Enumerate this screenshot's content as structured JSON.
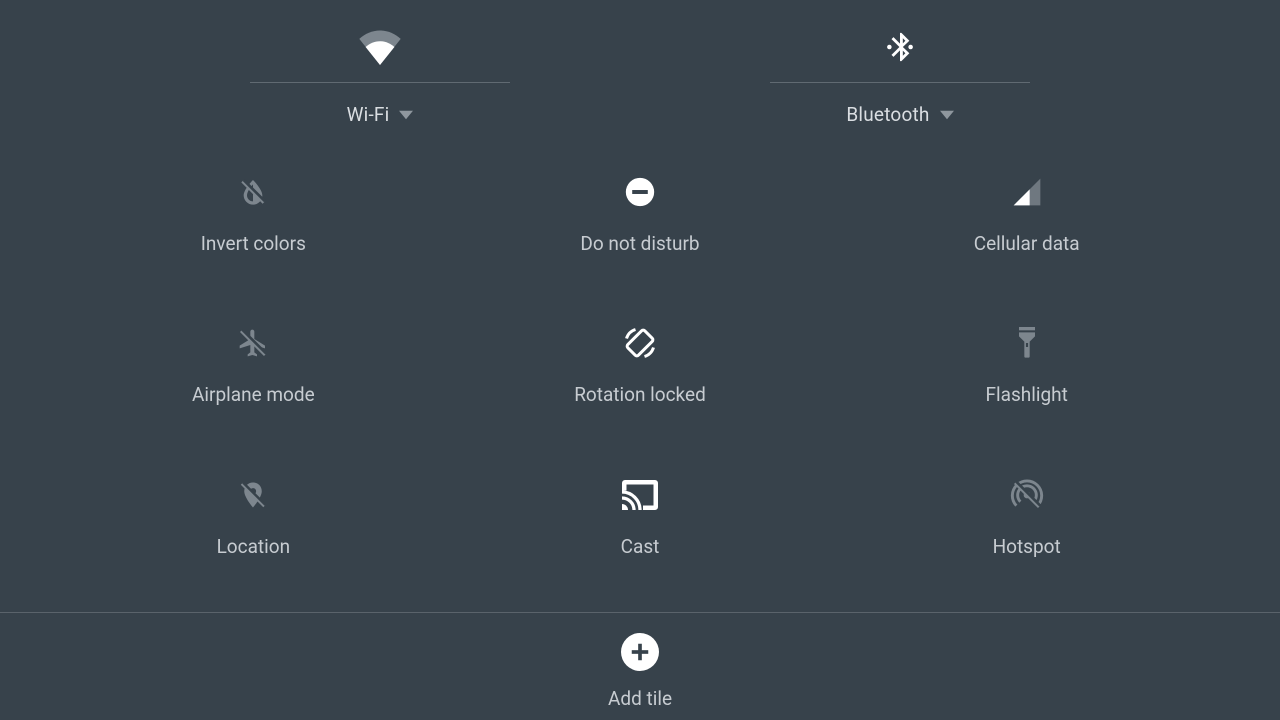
{
  "header": {
    "wifi": {
      "label": "Wi-Fi"
    },
    "bluetooth": {
      "label": "Bluetooth"
    }
  },
  "tiles": {
    "invert_colors": {
      "label": "Invert colors"
    },
    "dnd": {
      "label": "Do not disturb"
    },
    "cellular": {
      "label": "Cellular data"
    },
    "airplane": {
      "label": "Airplane mode"
    },
    "rotation": {
      "label": "Rotation locked"
    },
    "flashlight": {
      "label": "Flashlight"
    },
    "location": {
      "label": "Location"
    },
    "cast": {
      "label": "Cast"
    },
    "hotspot": {
      "label": "Hotspot"
    }
  },
  "footer": {
    "add_tile_label": "Add tile"
  }
}
